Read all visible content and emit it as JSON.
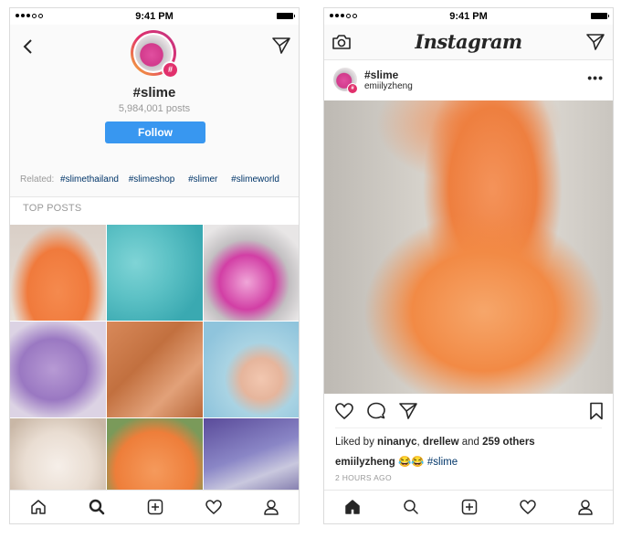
{
  "status_bar": {
    "time": "9:41 PM"
  },
  "hashtag_page": {
    "title": "#slime",
    "posts_count": "5,984,001 posts",
    "follow_label": "Follow",
    "badge_glyph": "#",
    "related_label": "Related:",
    "related_tags": [
      "#slimethailand",
      "#slimeshop",
      "#slimer",
      "#slimeworld"
    ],
    "section_title": "TOP POSTS",
    "grid": [
      "orange-foam-slime",
      "blue-glitter-slime",
      "pink-glitter-slime",
      "purple-slime",
      "orange-clear-slime",
      "blue-hands-slime",
      "white-cloud-slime",
      "orange-dish-slime",
      "purple-glitter-slime"
    ]
  },
  "feed": {
    "logo": "Instagram",
    "post": {
      "tag": "#slime",
      "username": "emiilyzheng",
      "more_glyph": "•••",
      "likes_prefix": "Liked by",
      "liker1": "ninanyc",
      "sep": ",",
      "liker2": "drellew",
      "and": "and",
      "others": "259 others",
      "caption_user": "emiilyzheng",
      "caption_emoji": "😂😂",
      "caption_tag": "#slime",
      "time_ago": "2 HOURS AGO"
    }
  },
  "nav_icons": [
    "home-icon",
    "search-icon",
    "add-icon",
    "heart-icon",
    "profile-icon"
  ],
  "colors": {
    "follow_blue": "#3897f0",
    "hashtag_pink": "#e1306c",
    "link_blue": "#003569"
  }
}
